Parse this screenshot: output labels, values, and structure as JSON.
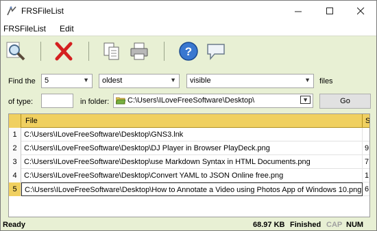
{
  "window": {
    "title": "FRSFileList"
  },
  "menu": {
    "items": [
      "FRSFileList",
      "Edit"
    ]
  },
  "form": {
    "find_label": "Find the",
    "count_value": "5",
    "order_value": "oldest",
    "visibility_value": "visible",
    "files_label": "files",
    "type_label": "of type:",
    "type_value": "",
    "folder_label": "in folder:",
    "folder_value": "C:\\Users\\ILoveFreeSoftware\\Desktop\\",
    "go_label": "Go"
  },
  "grid": {
    "headers": {
      "file": "File",
      "size": "S"
    },
    "rows": [
      {
        "num": "1",
        "path": "C:\\Users\\ILoveFreeSoftware\\Desktop\\GNS3.lnk",
        "size": ""
      },
      {
        "num": "2",
        "path": "C:\\Users\\ILoveFreeSoftware\\Desktop\\DJ Player in Browser PlayDeck.png",
        "size": "9"
      },
      {
        "num": "3",
        "path": "C:\\Users\\ILoveFreeSoftware\\Desktop\\use Markdown Syntax in HTML Documents.png",
        "size": "7"
      },
      {
        "num": "4",
        "path": "C:\\Users\\ILoveFreeSoftware\\Desktop\\Convert YAML to JSON Online free.png",
        "size": "1"
      },
      {
        "num": "5",
        "path": "C:\\Users\\ILoveFreeSoftware\\Desktop\\How to Annotate a Video using Photos App of Windows 10.png",
        "size": "6"
      }
    ],
    "selected_row": 5
  },
  "status": {
    "state": "Ready",
    "total_size": "68.97 KB",
    "result": "Finished",
    "cap": "CAP",
    "num": "NUM"
  },
  "colors": {
    "background": "#e8f0d4",
    "header": "#f0d060"
  }
}
